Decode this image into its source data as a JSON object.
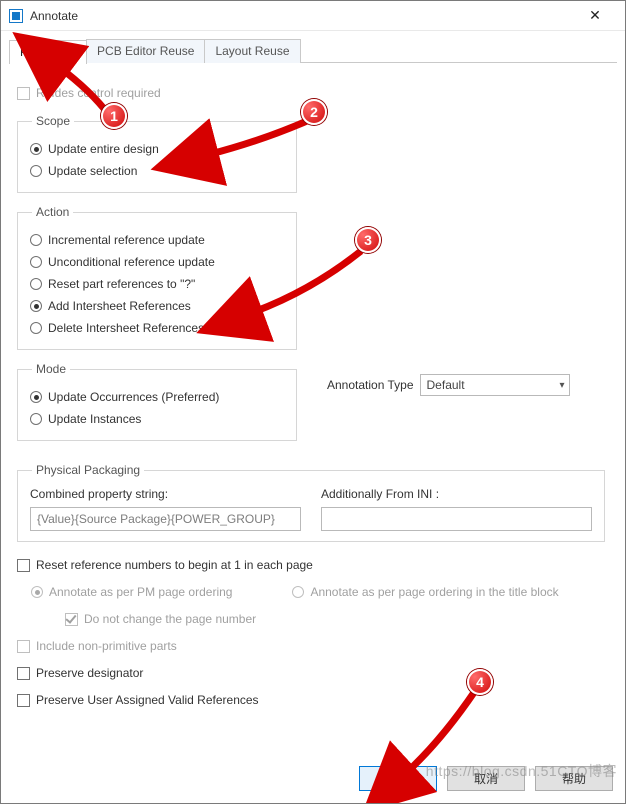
{
  "window": {
    "title": "Annotate"
  },
  "tabs": [
    {
      "label": "Packaging",
      "active": true
    },
    {
      "label": "PCB Editor Reuse",
      "active": false
    },
    {
      "label": "Layout Reuse",
      "active": false
    }
  ],
  "refdes_control": {
    "label": "Refdes control required",
    "checked": false,
    "enabled": false
  },
  "scope": {
    "legend": "Scope",
    "options": [
      {
        "label": "Update entire design",
        "selected": true
      },
      {
        "label": "Update selection",
        "selected": false
      }
    ]
  },
  "action": {
    "legend": "Action",
    "options": [
      {
        "label": "Incremental reference update",
        "selected": false
      },
      {
        "label": "Unconditional reference update",
        "selected": false
      },
      {
        "label": "Reset part references to \"?\"",
        "selected": false
      },
      {
        "label": "Add Intersheet References",
        "selected": true
      },
      {
        "label": "Delete Intersheet References",
        "selected": false
      }
    ]
  },
  "mode": {
    "legend": "Mode",
    "options": [
      {
        "label": "Update Occurrences (Preferred)",
        "selected": true
      },
      {
        "label": "Update Instances",
        "selected": false
      }
    ]
  },
  "annotation_type": {
    "label": "Annotation Type",
    "value": "Default"
  },
  "phys": {
    "legend": "Physical Packaging",
    "combined_label": "Combined property string:",
    "combined_value": "{Value}{Source Package}{POWER_GROUP}",
    "ini_label": "Additionally From INI :",
    "ini_value": ""
  },
  "opts": {
    "reset_begin1": {
      "label": "Reset reference numbers to begin at 1 in each page",
      "checked": false
    },
    "annotate_pm": {
      "label": "Annotate as per PM page ordering",
      "selected": true,
      "enabled": false
    },
    "annotate_title": {
      "label": "Annotate as per page ordering in the title block",
      "selected": false,
      "enabled": false
    },
    "no_change_page": {
      "label": "Do not change the page number",
      "checked": true,
      "enabled": false
    },
    "include_nonprim": {
      "label": "Include non-primitive parts",
      "checked": false,
      "enabled": false
    },
    "preserve_designator": {
      "label": "Preserve designator",
      "checked": false
    },
    "preserve_user_valid": {
      "label": "Preserve User Assigned Valid References",
      "checked": false
    }
  },
  "buttons": {
    "ok": "确定",
    "cancel": "取消",
    "help": "帮助"
  },
  "callouts": [
    "1",
    "2",
    "3",
    "4"
  ],
  "watermark": "https://blog.csdn.51CTO博客"
}
